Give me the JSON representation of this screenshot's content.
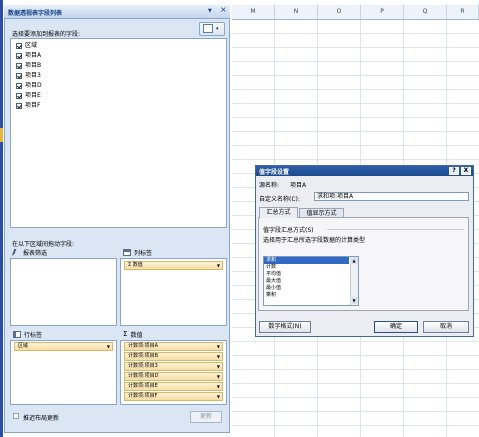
{
  "sheet": {
    "columns": [
      "M",
      "N",
      "O",
      "P",
      "Q",
      "R"
    ]
  },
  "pane": {
    "title": "数据透视表字段列表",
    "menu_arrow": "▼",
    "close": "×",
    "choose_label": "选择要添加到报表的字段:",
    "layout_arrow": "▾",
    "fields": [
      "区域",
      "项目A",
      "项目B",
      "项目3",
      "项目D",
      "项目E",
      "项目F"
    ],
    "drag_label": "在以下区域间拖动字段:",
    "zones": {
      "report_filter": "报表筛选",
      "column_labels": "列标签",
      "row_labels": "行标签",
      "values": "数值"
    },
    "column_chip": "Σ 数值",
    "row_chip": "区域",
    "value_chips": [
      "计数项:项目A",
      "计数项:项目B",
      "计数项:项目3",
      "计数项:项目D",
      "计数项:项目E",
      "计数项:项目F"
    ],
    "chip_arrow": "▼",
    "defer_label": "推迟布局更新",
    "update_button": "更新"
  },
  "dialog": {
    "title": "值字段设置",
    "help": "?",
    "close": "X",
    "source_label": "源名称:",
    "source_value": "项目A",
    "custom_label": "自定义名称(C):",
    "custom_value": "求和项:项目A",
    "tabs": [
      "汇总方式",
      "值显示方式"
    ],
    "summarize_by": "值字段汇总方式(S)",
    "choose_type": "选择用于汇总所选字段数据的计算类型",
    "functions": [
      "求和",
      "计数",
      "平均值",
      "最大值",
      "最小值",
      "乘积"
    ],
    "selected_function": "求和",
    "scroll_up": "▲",
    "scroll_down": "▼",
    "number_format_button": "数字格式(N)",
    "ok_button": "确定",
    "cancel_button": "取消"
  }
}
